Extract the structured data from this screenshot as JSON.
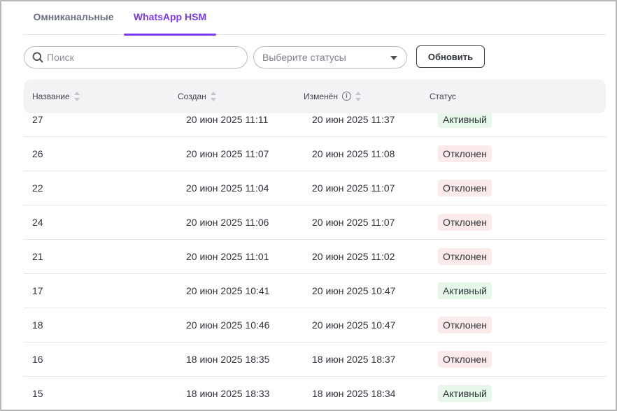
{
  "tabs": [
    {
      "label": "Омниканальные",
      "active": false
    },
    {
      "label": "WhatsApp HSM",
      "active": true
    }
  ],
  "toolbar": {
    "search_placeholder": "Поиск",
    "search_value": "",
    "status_select_placeholder": "Выберите статусы",
    "refresh_label": "Обновить"
  },
  "table": {
    "columns": [
      "Название",
      "Создан",
      "Изменён",
      "Статус"
    ],
    "rows": [
      {
        "name": "27",
        "created": "20 июн 2025 11:11",
        "modified": "20 июн 2025 11:37",
        "status": "Активный",
        "status_type": "active"
      },
      {
        "name": "26",
        "created": "20 июн 2025 11:07",
        "modified": "20 июн 2025 11:08",
        "status": "Отклонен",
        "status_type": "rejected"
      },
      {
        "name": "22",
        "created": "20 июн 2025 11:04",
        "modified": "20 июн 2025 11:07",
        "status": "Отклонен",
        "status_type": "rejected"
      },
      {
        "name": "24",
        "created": "20 июн 2025 11:06",
        "modified": "20 июн 2025 11:07",
        "status": "Отклонен",
        "status_type": "rejected"
      },
      {
        "name": "21",
        "created": "20 июн 2025 11:01",
        "modified": "20 июн 2025 11:02",
        "status": "Отклонен",
        "status_type": "rejected"
      },
      {
        "name": "17",
        "created": "20 июн 2025 10:41",
        "modified": "20 июн 2025 10:47",
        "status": "Активный",
        "status_type": "active"
      },
      {
        "name": "18",
        "created": "20 июн 2025 10:46",
        "modified": "20 июн 2025 10:47",
        "status": "Отклонен",
        "status_type": "rejected"
      },
      {
        "name": "16",
        "created": "18 июн 2025 18:35",
        "modified": "18 июн 2025 18:37",
        "status": "Отклонен",
        "status_type": "rejected"
      },
      {
        "name": "15",
        "created": "18 июн 2025 18:33",
        "modified": "18 июн 2025 18:34",
        "status": "Активный",
        "status_type": "active"
      }
    ]
  },
  "colors": {
    "accent": "#7c3aed",
    "active_badge_bg": "#e6f6e8",
    "rejected_badge_bg": "#fbeaea"
  },
  "icons": {
    "search": "search-icon",
    "dropdown": "chevron-down-icon",
    "sort": "sort-icon",
    "info": "info-icon"
  }
}
